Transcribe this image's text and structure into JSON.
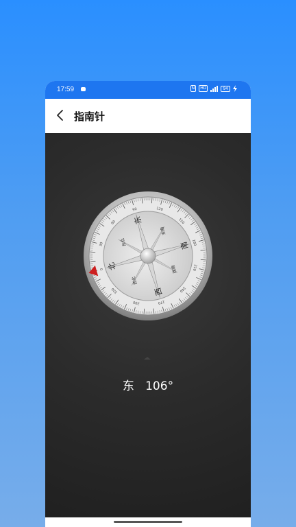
{
  "status_bar": {
    "time": "17:59",
    "icons": [
      "message-icon",
      "nfc-icon",
      "hd-icon",
      "signal-icon",
      "battery-icon",
      "charging-icon"
    ],
    "nfc_label": "N",
    "hd_label": "HD",
    "network_label": "4G",
    "battery_level": "94"
  },
  "toolbar": {
    "title": "指南针",
    "back_icon": "chevron-left-icon"
  },
  "compass": {
    "heading_deg": 106,
    "direction_label": "东",
    "reading": "东   106°",
    "cardinal_labels": {
      "north": "北",
      "east": "东",
      "south": "南",
      "west": "西"
    },
    "intercardinal_labels": {
      "northeast": "东北",
      "southeast": "东南",
      "southwest": "西南",
      "northwest": "西北"
    },
    "degree_tick_labels": [
      "0",
      "30",
      "60",
      "90",
      "120",
      "150",
      "180",
      "210",
      "240",
      "270",
      "300",
      "330"
    ],
    "colors": {
      "bezel": "#c8c8c8",
      "face": "#d9d9d9",
      "north_marker": "#cc1f1f",
      "background": "#2b2b2b"
    }
  }
}
